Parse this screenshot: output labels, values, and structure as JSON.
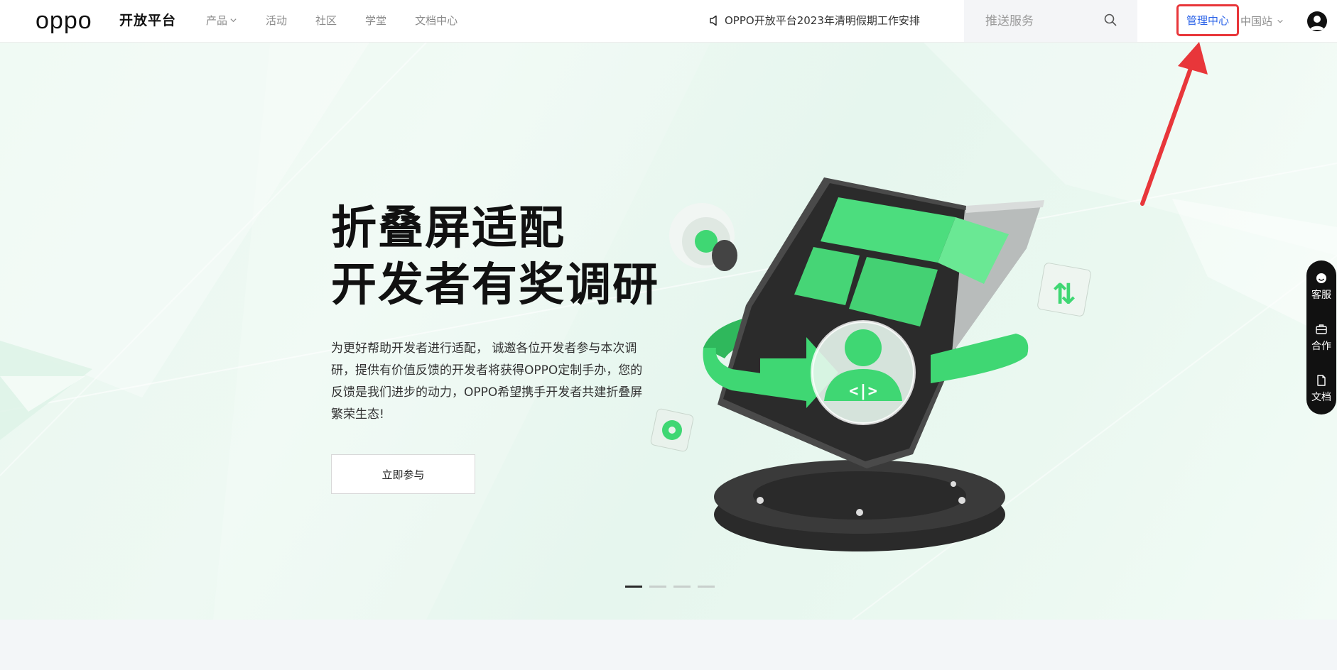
{
  "header": {
    "logo_text": "oppo",
    "platform_name": "开放平台",
    "nav": [
      {
        "label": "产品",
        "has_dropdown": true
      },
      {
        "label": "活动",
        "has_dropdown": false
      },
      {
        "label": "社区",
        "has_dropdown": false
      },
      {
        "label": "学堂",
        "has_dropdown": false
      },
      {
        "label": "文档中心",
        "has_dropdown": false
      }
    ],
    "notice": {
      "icon": "speaker-icon",
      "text": "OPPO开放平台2023年清明假期工作安排"
    },
    "search": {
      "placeholder": "推送服务",
      "icon": "search-icon"
    },
    "management_center": "管理中心",
    "region": "中国站",
    "avatar_icon": "user-avatar-icon"
  },
  "banner": {
    "title_lines": [
      "折叠屏适配",
      "开发者有奖调研"
    ],
    "description": "为更好帮助开发者进行适配， 诚邀各位开发者参与本次调研，提供有价值反馈的开发者将获得OPPO定制手办，您的反馈是我们进步的动力，OPPO希望携手开发者共建折叠屏繁荣生态!",
    "cta_label": "立即参与",
    "carousel": {
      "slides": 4,
      "active": 1
    }
  },
  "sidebar": [
    {
      "label": "客服",
      "icon": "customer-service-icon"
    },
    {
      "label": "合作",
      "icon": "briefcase-icon"
    },
    {
      "label": "文档",
      "icon": "document-icon"
    }
  ],
  "colors": {
    "accent_blue": "#2b63e8",
    "highlight_red": "#e8363a",
    "brand_green": "#3fd773",
    "banner_bg": "#e9f7ef",
    "sidebar_bg": "#111111"
  }
}
